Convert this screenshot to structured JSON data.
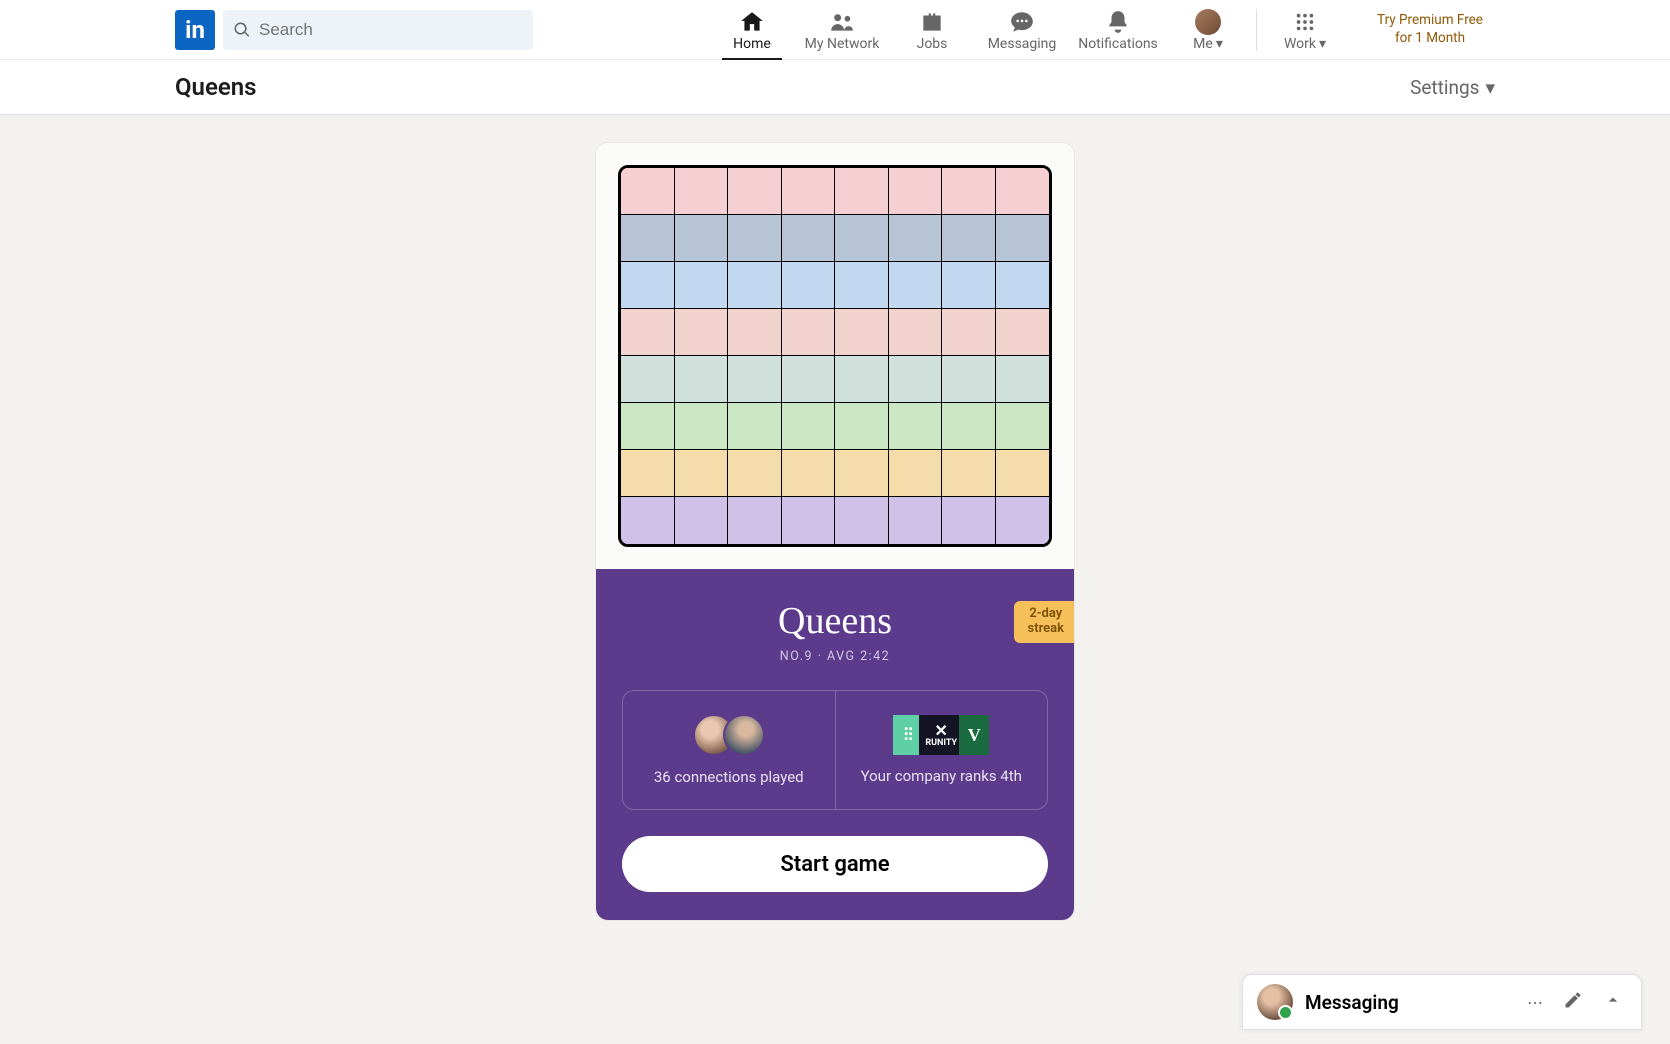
{
  "nav": {
    "search_placeholder": "Search",
    "items": {
      "home": "Home",
      "network": "My Network",
      "jobs": "Jobs",
      "messaging": "Messaging",
      "notifications": "Notifications",
      "me": "Me",
      "work": "Work"
    },
    "premium_line1": "Try Premium Free",
    "premium_line2": "for 1 Month"
  },
  "subheader": {
    "title": "Queens",
    "settings": "Settings"
  },
  "game": {
    "title": "Queens",
    "subline": "NO.9 · AVG 2:42",
    "streak_line1": "2-day",
    "streak_line2": "streak",
    "connections_played": "36 connections played",
    "company_rank": "Your company ranks 4th",
    "start_label": "Start game",
    "grid_colors": [
      "#f6cfd2",
      "#b6c4d6",
      "#c0d9f1",
      "#f2d2cd",
      "#cfe1da",
      "#cbe6c3",
      "#f5dcab",
      "#d0c1e8"
    ],
    "company_logo_letters": [
      "",
      "RUNITY",
      "V"
    ]
  },
  "messaging_dock": {
    "label": "Messaging"
  }
}
